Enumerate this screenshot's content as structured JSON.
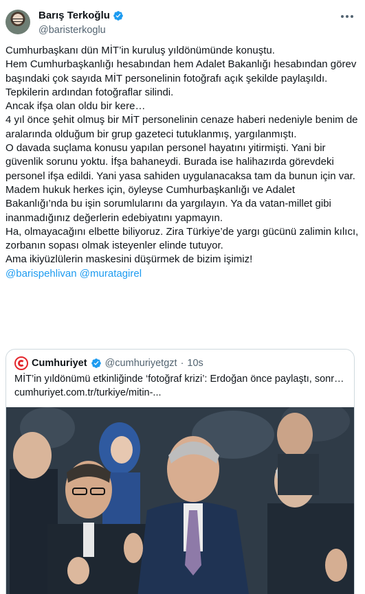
{
  "author": {
    "name": "Barış Terkoğlu",
    "handle": "@baristerkoglu",
    "verified": true,
    "icons": {
      "avatar": "avatar-photo",
      "verified": "verified-badge-icon",
      "more": "more-options-icon"
    }
  },
  "tweet": {
    "lines": [
      "Cumhurbaşkanı dün MİT’in kuruluş yıldönümünde konuştu.",
      "Hem Cumhurbaşkanlığı hesabından hem Adalet Bakanlığı hesabından görev başındaki çok sayıda MİT personelinin fotoğrafı açık şekilde paylaşıldı.",
      "Tepkilerin ardından fotoğraflar silindi.",
      "Ancak ifşa olan oldu bir kere…",
      "4 yıl önce şehit olmuş bir MİT personelinin cenaze haberi nedeniyle benim de aralarında olduğum bir grup gazeteci tutuklanmış, yargılanmıştı.",
      "O davada suçlama konusu yapılan personel hayatını yitirmişti. Yani bir güvenlik sorunu yoktu. İfşa bahaneydi. Burada ise halihazırda görevdeki personel ifşa edildi. Yani yasa sahiden uygulanacaksa tam da bunun için var.",
      "Madem hukuk herkes için, öyleyse Cumhurbaşkanlığı ve Adalet Bakanlığı’nda bu işin sorumlularını da yargılayın. Ya da vatan-millet gibi inanmadığınız değerlerin edebiyatını yapmayın.",
      "Ha, olmayacağını elbette biliyoruz. Zira Türkiye’de yargı gücünü zalimin kılıcı, zorbanın sopası olmak isteyenler elinde tutuyor.",
      "Ama ikiyüzlülerin maskesini düşürmek de bizim işimiz!"
    ],
    "mentions": [
      "@barispehlivan",
      "@muratagirel"
    ]
  },
  "quote": {
    "name": "Cumhuriyet",
    "handle": "@cumhuriyetgzt",
    "separator": "·",
    "time": "10s",
    "verified": true,
    "title": "MİT’in yıldönümü etkinliğinde ‘fotoğraf krizi’: Erdoğan önce paylaştı, sonra sildi",
    "link": "cumhuriyet.com.tr/turkiye/mitin-...",
    "colors": {
      "brand": "#e3262c",
      "verified": "#1d9bf0"
    },
    "icons": {
      "logo": "cumhuriyet-logo-icon",
      "verified": "verified-badge-icon"
    }
  },
  "colors": {
    "text": "#0f1419",
    "secondary": "#536471",
    "link": "#1d9bf0",
    "border": "#cfd9de"
  }
}
